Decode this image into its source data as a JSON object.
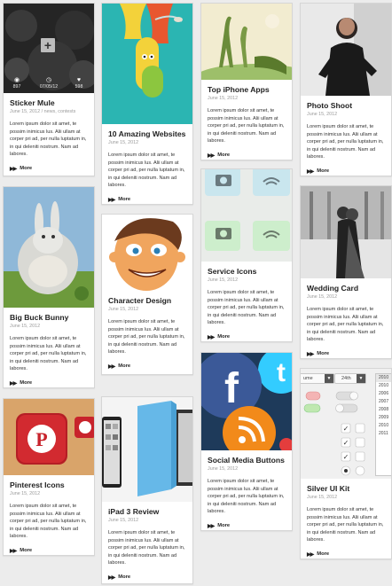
{
  "more_label": "More",
  "lorem": "Lorem ipsum dolor sit amet, te possim inimicus lus. Alii ullam at corper pri ad, per nulla luptatum in, in qui deleniti nostrum. Nam ad labores.",
  "cards": {
    "sticker_mule": {
      "title": "Sticker Mule",
      "date": "June 15, 2012",
      "tags": "/ news, contests",
      "stats": {
        "views": "897",
        "date": "07/05/12",
        "likes": "598"
      }
    },
    "amazing_websites": {
      "title": "10 Amazing Websites",
      "date": "June 15, 2012"
    },
    "top_iphone_apps": {
      "title": "Top iPhone Apps",
      "date": "June 15, 2012"
    },
    "photo_shoot": {
      "title": "Photo Shoot",
      "date": "June 15, 2012"
    },
    "big_buck_bunny": {
      "title": "Big Buck Bunny",
      "date": "June 15, 2012"
    },
    "character_design": {
      "title": "Character Design",
      "date": "June 15, 2012"
    },
    "service_icons": {
      "title": "Service Icons",
      "date": "June 15, 2012"
    },
    "wedding_card": {
      "title": "Wedding Card",
      "date": "June 15, 2012"
    },
    "pinterest_icons": {
      "title": "Pinterest Icons",
      "date": "June 15, 2012"
    },
    "ipad3_review": {
      "title": "iPad 3 Review",
      "date": "June 15, 2012"
    },
    "social_media_buttons": {
      "title": "Social Media Buttons",
      "date": "June 15, 2012"
    },
    "silver_ui_kit": {
      "title": "Silver UI Kit",
      "date": "June 15, 2012",
      "ui_values": {
        "select1": "ume",
        "select2": "24th",
        "years": [
          "2010",
          "2010",
          "2006",
          "2007",
          "2008",
          "2009",
          "2010",
          "2011"
        ]
      }
    }
  },
  "colors": {
    "page_bg": "#ececec",
    "card_bg": "#ffffff",
    "border": "#d6d6d6",
    "pinterest_red": "#c8232c",
    "facebook_blue": "#3b5998",
    "twitter_blue": "#33ccff",
    "rss_orange": "#f28a1a"
  },
  "icons": {
    "more": "double-chevron-right-icon",
    "zoom": "plus-icon",
    "views": "eye-icon",
    "date": "clock-icon",
    "likes": "heart-icon"
  }
}
